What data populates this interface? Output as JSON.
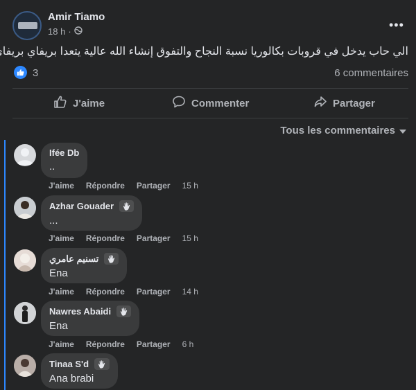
{
  "post": {
    "author": "Amir Tiamo",
    "time": "18 h",
    "separator": "·",
    "privacy_icon": "public-globe-icon",
    "text": "الي حاب يدخل في قروبات بكالوريا نسبة النجاح والتفوق إنشاء الله عالية يتعدا بريفاي بريفاي",
    "reaction_count": "3",
    "comments_count": "6 commentaires",
    "more_label": "•••"
  },
  "actions": {
    "like": "J'aime",
    "comment": "Commenter",
    "share": "Partager"
  },
  "sort_label": "Tous les commentaires",
  "comment_actions": {
    "like": "J'aime",
    "reply": "Répondre",
    "share": "Partager"
  },
  "comments": [
    {
      "name": "Ifée Db",
      "text": "..",
      "time": "15 h",
      "badge": false
    },
    {
      "name": "Azhar Gouader",
      "text": "...",
      "time": "15 h",
      "badge": true
    },
    {
      "name": "تسنيم عامري",
      "text": "Ena",
      "time": "14 h",
      "badge": true
    },
    {
      "name": "Nawres Abaidi",
      "text": "Ena",
      "time": "6 h",
      "badge": true
    },
    {
      "name": "Tinaa S'd",
      "text": "Ana brabi",
      "time": "",
      "badge": true
    }
  ],
  "colors": {
    "background": "#242526",
    "bubble": "#3a3b3c",
    "accent": "#2d88ff",
    "text_primary": "#e4e6eb",
    "text_secondary": "#b0b3b8"
  }
}
